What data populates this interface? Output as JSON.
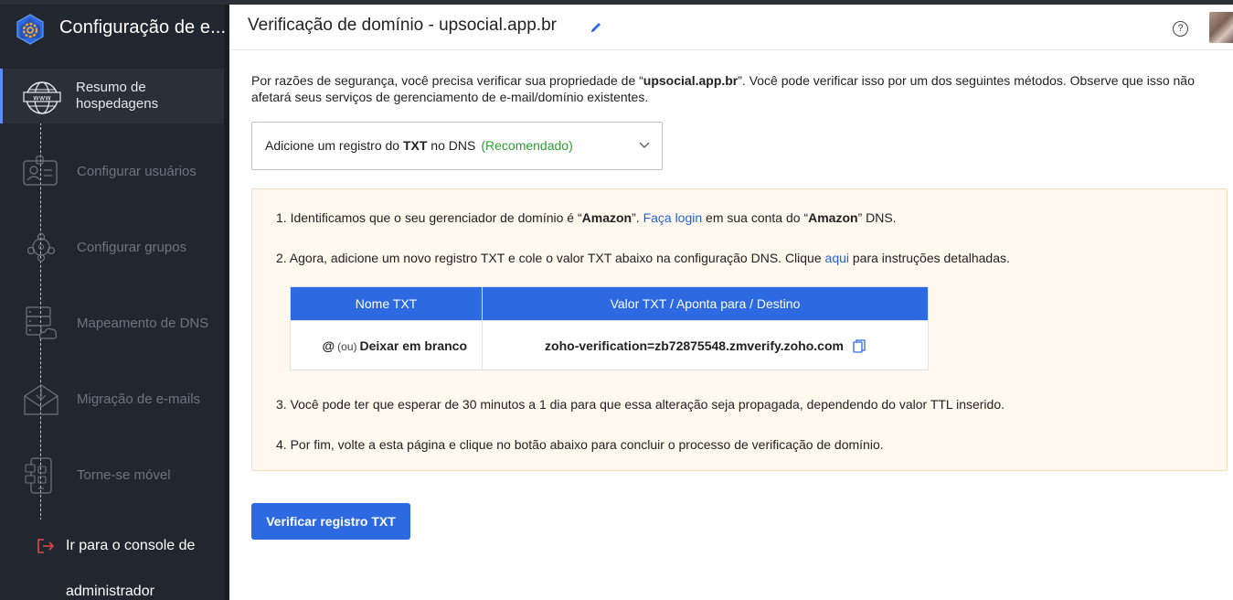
{
  "app": {
    "title": "Configuração de e..."
  },
  "sidebar": {
    "steps": [
      {
        "line1": "Resumo de",
        "line2": "hospedagens",
        "icon": "globe-www-icon",
        "active": true
      },
      {
        "label": "Configurar usuários",
        "icon": "user-id-card-icon"
      },
      {
        "label": "Configurar grupos",
        "icon": "group-people-icon"
      },
      {
        "label": "Mapeamento de DNS",
        "icon": "server-cloud-icon"
      },
      {
        "label": "Migração de e-mails",
        "icon": "mail-download-icon"
      },
      {
        "label": "Torne-se móvel",
        "icon": "mobile-devices-icon"
      }
    ],
    "footer": {
      "label": "Ir para o console de administrador",
      "icon": "exit-icon"
    }
  },
  "header": {
    "title": "Verificação de domínio - upsocial.app.br",
    "help": "?"
  },
  "intro": {
    "before": "Por razões de segurança, você precisa verificar sua propriedade de “",
    "domain": "upsocial.app.br",
    "after": "”. Você pode verificar isso por um dos seguintes métodos. Observe que isso não afetará seus serviços de gerenciamento de e-mail/domínio existentes."
  },
  "method_select": {
    "prefix": "Adicione um registro do ",
    "bold": "TXT",
    "suffix": " no DNS",
    "recommended": "(Recomendado)"
  },
  "instructions": {
    "step1": {
      "a": "1. Identificamos que o seu gerenciador de domínio é “",
      "provider": "Amazon",
      "b": "”. ",
      "link": "Faça login",
      "c": " em sua conta do “",
      "provider2": "Amazon",
      "d": "” DNS."
    },
    "step2": {
      "a": "2. Agora, adicione um novo registro TXT e cole o valor TXT abaixo na configuração DNS. Clique ",
      "link": "aqui",
      "b": " para instruções detalhadas."
    },
    "table": {
      "col1": "Nome TXT",
      "col2": "Valor TXT / Aponta para / Destino",
      "name_at": "@",
      "name_or": "(ou)",
      "name_blank": "Deixar em branco",
      "value": "zoho-verification=zb72875548.zmverify.zoho.com"
    },
    "step3": "3. Você pode ter que esperar de 30 minutos a 1 dia para que essa alteração seja propagada, dependendo do valor TTL inserido.",
    "step4": "4. Por fim, volte a esta página e clique no botão abaixo para concluir o processo de verificação de domínio."
  },
  "actions": {
    "verify_label": "Verificar registro TXT"
  },
  "colors": {
    "sidebar_bg": "#22262e",
    "accent": "#2d6ae1",
    "recommended": "#2e9e34",
    "notice_bg": "#fff8ef"
  }
}
